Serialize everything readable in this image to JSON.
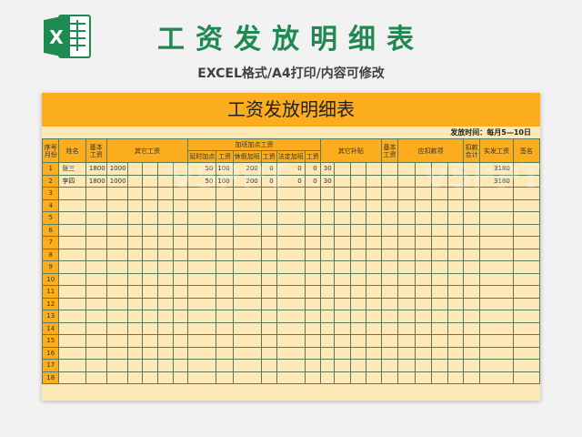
{
  "header": {
    "title": "工资发放明细表",
    "subtitle": "EXCEL格式/A4打印/内容可修改",
    "app_icon": "excel-icon",
    "icon_letter": "X",
    "accent_color": "#1e8a52"
  },
  "sheet": {
    "title": "工资发放明细表",
    "paytime_label": "发放时间：每月5—10日",
    "title_bg": "#fbad1d",
    "cell_bg": "#fde8b8",
    "headers": {
      "seq": "序号\n月份",
      "name": "姓名",
      "base": "基本\n工资",
      "other_wage": "其它工资",
      "overtime": "加班加点工资",
      "ot_extend": "延时加点",
      "wage1": "工资",
      "ot_holiday": "休假加班",
      "wage2": "工资",
      "ot_legal": "法定加班",
      "wage3": "工资",
      "other_allow": "其它补贴",
      "base2": "基本\n工资",
      "deduct_items": "应扣款项",
      "deduct_total": "扣款\n合计",
      "net_pay": "实发工资",
      "signature": "签名"
    },
    "rows": [
      {
        "seq": "1",
        "name": "张三",
        "base": "1800",
        "other": "1000",
        "ot1": "50",
        "w1": "100",
        "ot2": "200",
        "w2": "0",
        "ot3": "0",
        "w3": "0",
        "allow": "30",
        "net": "3180"
      },
      {
        "seq": "2",
        "name": "李四",
        "base": "1800",
        "other": "1000",
        "ot1": "50",
        "w1": "100",
        "ot2": "200",
        "w2": "0",
        "ot3": "0",
        "w3": "0",
        "allow": "30",
        "net": "3180"
      },
      {
        "seq": "3"
      },
      {
        "seq": "4"
      },
      {
        "seq": "5"
      },
      {
        "seq": "6"
      },
      {
        "seq": "7"
      },
      {
        "seq": "8"
      },
      {
        "seq": "9"
      },
      {
        "seq": "10"
      },
      {
        "seq": "11"
      },
      {
        "seq": "12"
      },
      {
        "seq": "13"
      },
      {
        "seq": "14"
      },
      {
        "seq": "15"
      },
      {
        "seq": "16"
      },
      {
        "seq": "17"
      },
      {
        "seq": "18"
      }
    ]
  },
  "watermark": {
    "left": "V5PPT",
    "right": "V5PPT"
  }
}
